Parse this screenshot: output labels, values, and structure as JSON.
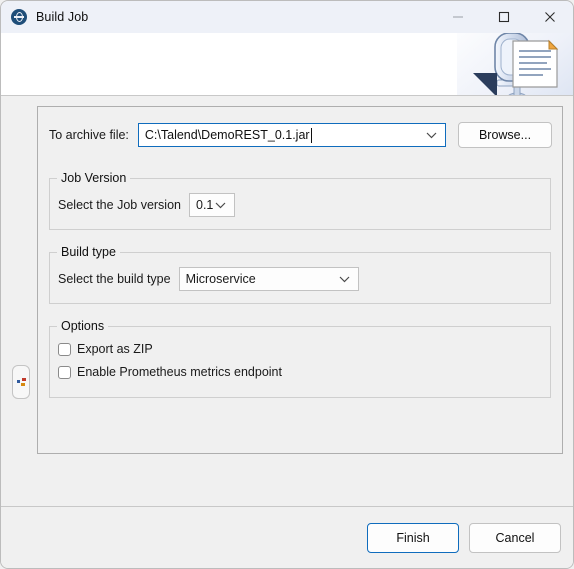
{
  "window": {
    "title": "Build Job",
    "icon": "talend-logo-icon",
    "controls": {
      "minimize_label": "Minimize",
      "maximize_label": "Maximize",
      "close_label": "Close"
    }
  },
  "header": {
    "banner_icon": "job-document-icon"
  },
  "side": {
    "handle_name": "restore-panel-handle"
  },
  "archive": {
    "label": "To archive file:",
    "value": "C:\\Talend\\DemoREST_0.1.jar",
    "placeholder": "",
    "browse_label": "Browse..."
  },
  "job_version": {
    "group_title": "Job Version",
    "label": "Select the Job version",
    "value": "0.1",
    "options": [
      "0.1"
    ]
  },
  "build_type": {
    "group_title": "Build type",
    "label": "Select the build type",
    "value": "Microservice",
    "options": [
      "Microservice"
    ]
  },
  "options": {
    "group_title": "Options",
    "items": [
      {
        "label": "Export as ZIP",
        "checked": false
      },
      {
        "label": "Enable Prometheus metrics endpoint",
        "checked": false
      }
    ]
  },
  "footer": {
    "finish_label": "Finish",
    "cancel_label": "Cancel"
  },
  "colors": {
    "titlebar_bg": "#eef1f8",
    "body_bg": "#f0f0f0",
    "accent_focus": "#0f6cbd",
    "logo_blue": "#1f4e79",
    "text": "#101010"
  }
}
